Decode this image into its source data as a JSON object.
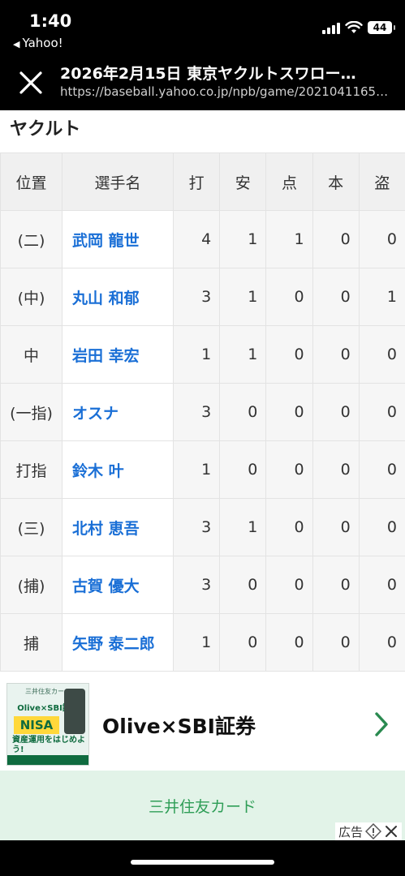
{
  "status_bar": {
    "time": "1:40",
    "back_app": "Yahoo!",
    "battery": "44"
  },
  "browser": {
    "title": "2026年2月15日 東京ヤクルトスワロー…",
    "url": "https://baseball.yahoo.co.jp/npb/game/2021041165…"
  },
  "team": {
    "name": "ヤクルト"
  },
  "table": {
    "headers": [
      "位置",
      "選手名",
      "打",
      "安",
      "点",
      "本",
      "盗"
    ],
    "rows": [
      {
        "pos": "(二)",
        "name": "武岡 龍世",
        "ab": "4",
        "h": "1",
        "rbi": "1",
        "hr": "0",
        "sb": "0"
      },
      {
        "pos": "(中)",
        "name": "丸山 和郁",
        "ab": "3",
        "h": "1",
        "rbi": "0",
        "hr": "0",
        "sb": "1"
      },
      {
        "pos": "中",
        "name": "岩田 幸宏",
        "ab": "1",
        "h": "1",
        "rbi": "0",
        "hr": "0",
        "sb": "0"
      },
      {
        "pos": "(一指)",
        "name": "オスナ",
        "ab": "3",
        "h": "0",
        "rbi": "0",
        "hr": "0",
        "sb": "0"
      },
      {
        "pos": "打指",
        "name": "鈴木 叶",
        "ab": "1",
        "h": "0",
        "rbi": "0",
        "hr": "0",
        "sb": "0"
      },
      {
        "pos": "(三)",
        "name": "北村 恵吾",
        "ab": "3",
        "h": "1",
        "rbi": "0",
        "hr": "0",
        "sb": "0"
      },
      {
        "pos": "(捕)",
        "name": "古賀 優大",
        "ab": "3",
        "h": "0",
        "rbi": "0",
        "hr": "0",
        "sb": "0"
      },
      {
        "pos": "捕",
        "name": "矢野 泰二郎",
        "ab": "1",
        "h": "0",
        "rbi": "0",
        "hr": "0",
        "sb": "0"
      }
    ]
  },
  "ad": {
    "image_header": "三井住友カード",
    "image_brand": "Olive×SBI証券",
    "image_badge": "NISA",
    "image_sub": "資産運用をはじめよう!",
    "title": "Olive×SBI証券",
    "cta": "三井住友カード",
    "label": "広告"
  },
  "colors": {
    "link": "#1a6fd6",
    "cta": "#2f9e57",
    "cta_bg": "#e2f3e8"
  }
}
